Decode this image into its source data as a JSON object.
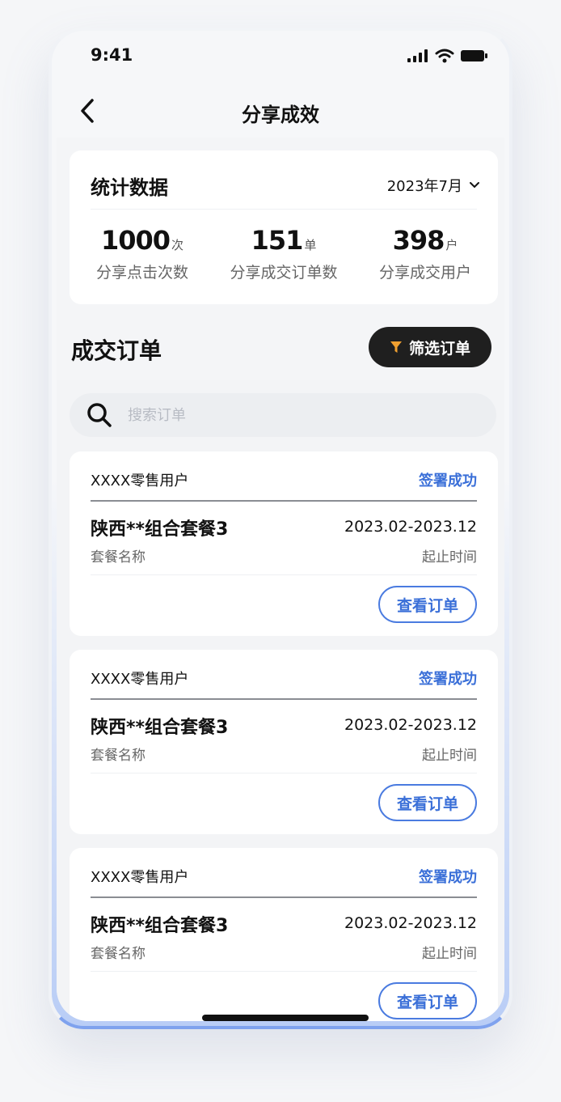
{
  "status_bar": {
    "time": "9:41"
  },
  "nav": {
    "title": "分享成效"
  },
  "stats": {
    "title": "统计数据",
    "month": "2023年7月",
    "items": [
      {
        "value": "1000",
        "unit": "次",
        "label": "分享点击次数"
      },
      {
        "value": "151",
        "unit": "单",
        "label": "分享成交订单数"
      },
      {
        "value": "398",
        "unit": "户",
        "label": "分享成交用户"
      }
    ]
  },
  "orders": {
    "title": "成交订单",
    "filter_label": "筛选订单",
    "search_placeholder": "搜索订单",
    "view_label": "查看订单",
    "items": [
      {
        "user": "XXXX零售用户",
        "status": "签署成功",
        "package": "陕西**组合套餐3",
        "package_label": "套餐名称",
        "period": "2023.02-2023.12",
        "period_label": "起止时间"
      },
      {
        "user": "XXXX零售用户",
        "status": "签署成功",
        "package": "陕西**组合套餐3",
        "package_label": "套餐名称",
        "period": "2023.02-2023.12",
        "period_label": "起止时间"
      },
      {
        "user": "XXXX零售用户",
        "status": "签署成功",
        "package": "陕西**组合套餐3",
        "package_label": "套餐名称",
        "period": "2023.02-2023.12",
        "period_label": "起止时间"
      }
    ]
  },
  "colors": {
    "accent": "#3a6fd8",
    "filter_bg": "#1f1f1f",
    "filter_icon": "#f0a030"
  }
}
